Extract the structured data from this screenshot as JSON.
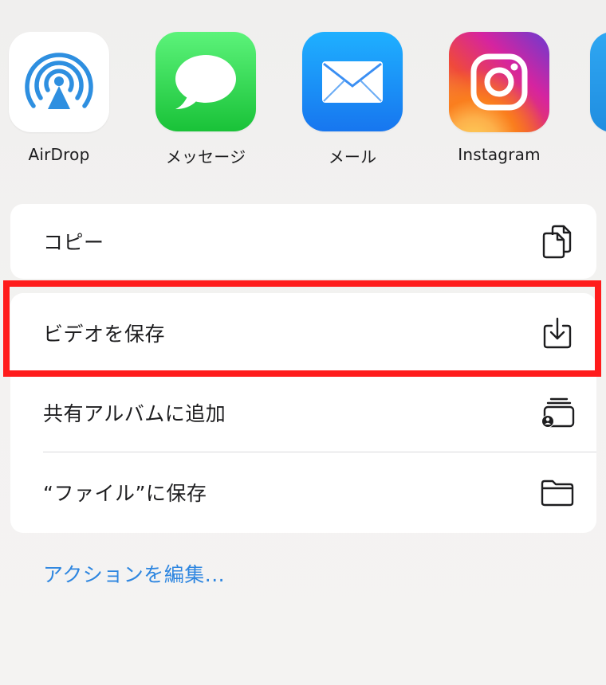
{
  "apps": [
    {
      "label": "AirDrop",
      "icon": "airdrop-icon"
    },
    {
      "label": "メッセージ",
      "icon": "messages-icon"
    },
    {
      "label": "メール",
      "icon": "mail-icon"
    },
    {
      "label": "Instagram",
      "icon": "instagram-icon"
    }
  ],
  "actions_group1": [
    {
      "label": "コピー",
      "icon": "copy-icon"
    }
  ],
  "actions_group2": [
    {
      "label": "ビデオを保存",
      "icon": "save-download-icon",
      "highlighted": true
    },
    {
      "label": "共有アルバムに追加",
      "icon": "shared-album-icon"
    },
    {
      "label": "“ファイル”に保存",
      "icon": "folder-icon"
    }
  ],
  "edit_actions_label": "アクションを編集...",
  "colors": {
    "highlight": "#ff1c1c",
    "link": "#2e86e0",
    "messages_green": "#19c238",
    "mail_blue": "#1776ef",
    "airdrop_blue": "#2e8fe0"
  }
}
